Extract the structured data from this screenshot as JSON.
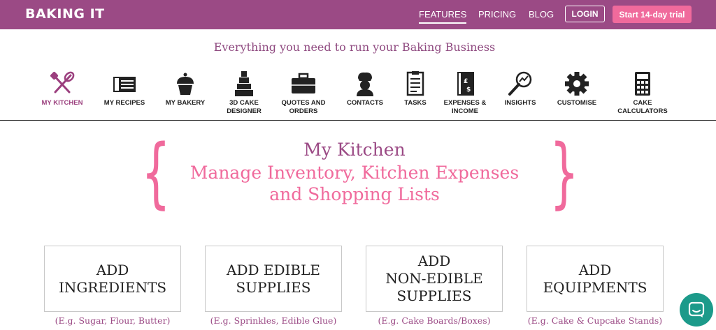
{
  "header": {
    "logo": "BAKING IT",
    "nav": [
      "FEATURES",
      "PRICING",
      "BLOG"
    ],
    "login_label": "LOGIN",
    "trial_label": "Start 14-day trial"
  },
  "tagline": "Everything you need to run your Baking Business",
  "features": [
    {
      "label": "MY KITCHEN",
      "icon": "whisk-spatula-icon"
    },
    {
      "label": "MY RECIPES",
      "icon": "recipe-book-icon"
    },
    {
      "label": "MY BAKERY",
      "icon": "cupcake-icon"
    },
    {
      "label": "3D CAKE DESIGNER",
      "icon": "tiered-cake-icon"
    },
    {
      "label": "QUOTES AND ORDERS",
      "icon": "briefcase-icon"
    },
    {
      "label": "CONTACTS",
      "icon": "chef-icon"
    },
    {
      "label": "TASKS",
      "icon": "clipboard-icon"
    },
    {
      "label": "EXPENSES & INCOME",
      "icon": "money-book-icon"
    },
    {
      "label": "INSIGHTS",
      "icon": "magnifier-chart-icon"
    },
    {
      "label": "CUSTOMISE",
      "icon": "gear-icon"
    },
    {
      "label": "CAKE CALCULATORS",
      "icon": "calculator-icon"
    }
  ],
  "hero": {
    "title": "My Kitchen",
    "subtitle_line1": "Manage Inventory, Kitchen Expenses",
    "subtitle_line2": "and Shopping Lists"
  },
  "cards": [
    {
      "line1": "ADD",
      "line2": "INGREDIENTS",
      "line3": "",
      "example": "(E.g. Sugar, Flour, Butter)"
    },
    {
      "line1": "ADD EDIBLE",
      "line2": "SUPPLIES",
      "line3": "",
      "example": "(E.g. Sprinkles, Edible Glue)"
    },
    {
      "line1": "ADD",
      "line2": "NON-EDIBLE",
      "line3": "SUPPLIES",
      "example": "(E.g. Cake Boards/Boxes)"
    },
    {
      "line1": "ADD",
      "line2": "EQUIPMENTS",
      "line3": "",
      "example": "(E.g. Cake & Cupcake Stands)"
    }
  ],
  "colors": {
    "brand_purple": "#9b4a85",
    "accent_pink": "#f06a9c",
    "chat_teal": "#1c9a8a"
  }
}
